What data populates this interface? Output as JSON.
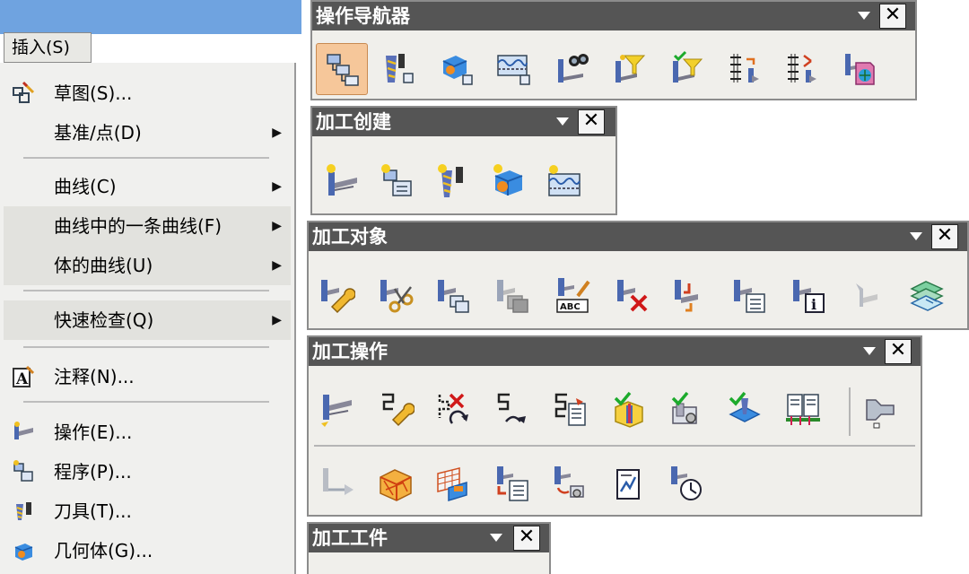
{
  "menu": {
    "tab_label": "插入(S)",
    "items": [
      {
        "label": "草图(S)...",
        "icon": "sketch-icon",
        "arrow": ""
      },
      {
        "label": "基准/点(D)",
        "icon": "",
        "arrow": "▶"
      },
      {
        "label": "曲线(C)",
        "icon": "",
        "arrow": "▶"
      },
      {
        "label": "曲线中的一条曲线(F)",
        "icon": "",
        "arrow": "▶"
      },
      {
        "label": "体的曲线(U)",
        "icon": "",
        "arrow": "▶"
      },
      {
        "label": "快速检查(Q)",
        "icon": "",
        "arrow": "▶"
      },
      {
        "label": "注释(N)...",
        "icon": "annotation-icon",
        "arrow": ""
      },
      {
        "label": "操作(E)...",
        "icon": "operation-icon",
        "arrow": ""
      },
      {
        "label": "程序(P)...",
        "icon": "program-icon",
        "arrow": ""
      },
      {
        "label": "刀具(T)...",
        "icon": "tool-icon",
        "arrow": ""
      },
      {
        "label": "几何体(G)...",
        "icon": "geometry-icon",
        "arrow": ""
      }
    ]
  },
  "toolbars": {
    "navigator": {
      "title": "操作导航器",
      "close": "✕",
      "buttons": [
        "program-order-view-icon",
        "machine-tool-view-icon",
        "geometry-view-icon",
        "machining-method-view-icon",
        "find-icon",
        "filter-icon",
        "filter-check-icon",
        "reorder-icon",
        "reorder-arrows-icon",
        "export-icon"
      ]
    },
    "create": {
      "title": "加工创建",
      "close": "✕",
      "buttons": [
        "create-operation-icon",
        "create-program-icon",
        "create-tool-icon",
        "create-geometry-icon",
        "create-method-icon"
      ]
    },
    "object": {
      "title": "加工对象",
      "close": "✕",
      "buttons": [
        "edit-object-icon",
        "cut-object-icon",
        "copy-object-icon",
        "paste-object-icon",
        "rename-object-icon",
        "delete-object-icon",
        "transform-object-icon",
        "object-list-icon",
        "object-info-icon",
        "disabled-object-icon",
        "object-layers-icon"
      ]
    },
    "operation": {
      "title": "加工操作",
      "close": "✕",
      "buttons": [
        "generate-toolpath-icon",
        "edit-toolpath-icon",
        "delete-toolpath-icon",
        "replay-toolpath-icon",
        "list-toolpath-icon",
        "verify-toolpath-icon",
        "simulate-machine-icon",
        "gouge-check-icon",
        "postprocess-icon",
        "spindle-icon",
        "output-cls-icon",
        "workpiece-icon",
        "material-icon",
        "shop-doc-icon",
        "batch-process-icon",
        "report-icon",
        "time-icon"
      ]
    },
    "workpiece": {
      "title": "加工工件",
      "close": "✕"
    }
  }
}
